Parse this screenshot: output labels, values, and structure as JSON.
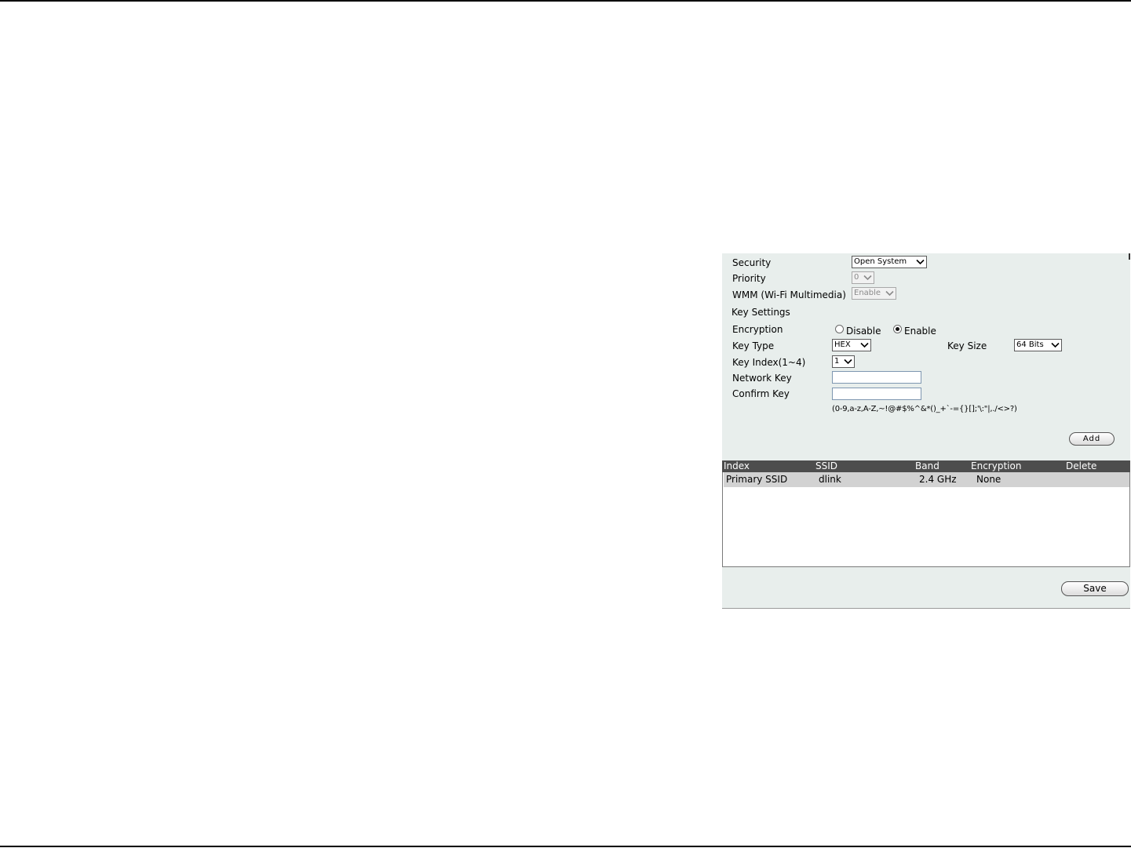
{
  "form": {
    "security": {
      "label": "Security",
      "value": "Open System"
    },
    "priority": {
      "label": "Priority",
      "value": "0"
    },
    "wmm": {
      "label": "WMM (Wi-Fi Multimedia)",
      "value": "Enable"
    },
    "key_settings_heading": "Key Settings",
    "encryption": {
      "label": "Encryption",
      "options": [
        "Disable",
        "Enable"
      ],
      "selected": "Enable"
    },
    "key_type": {
      "label": "Key Type",
      "value": "HEX"
    },
    "key_size": {
      "label": "Key Size",
      "value": "64 Bits"
    },
    "key_index": {
      "label": "Key Index(1~4)",
      "value": "1"
    },
    "network_key": {
      "label": "Network Key",
      "value": ""
    },
    "confirm_key": {
      "label": "Confirm Key",
      "value": ""
    },
    "allowed_chars_hint": "(0-9,a-z,A-Z,~!@#$%^&*()_+`-={}[];'\\:\"|,./<>?)",
    "add_label": "Add"
  },
  "table": {
    "columns": [
      "Index",
      "SSID",
      "Band",
      "Encryption",
      "Delete"
    ],
    "rows": [
      {
        "index": "Primary SSID",
        "ssid": "dlink",
        "band": "2.4 GHz",
        "encryption": "None",
        "delete": ""
      }
    ]
  },
  "save_label": "Save",
  "icons": {
    "dropdown": "chevron-down-icon"
  },
  "colors": {
    "panel_bg": "#e8eeec",
    "table_header_bg": "#4d4d4d",
    "selected_row_bg": "#d2d2d2"
  }
}
